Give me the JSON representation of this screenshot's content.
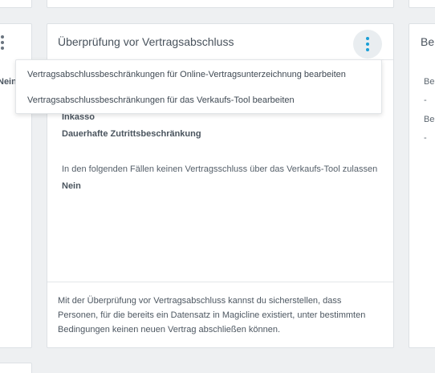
{
  "left_card": {
    "value": "Nein"
  },
  "main_card": {
    "title": "Überprüfung vor Vertragsabschluss",
    "items": [
      {
        "label": "Inkasso"
      },
      {
        "label": "Dauerhafte Zutrittsbeschränkung"
      }
    ],
    "question": "In den folgenden Fällen keinen Vertragsschluss über das Verkaufs-Tool zulassen",
    "answer": "Nein",
    "footer": "Mit der Überprüfung vor Vertragsabschluss kannst du sicherstellen, dass Personen, für die bereits ein Datensatz in Magicline existiert, unter bestimmten Bedingungen keinen neuen Vertrag abschließen können."
  },
  "dropdown_menu": {
    "items": [
      {
        "label": "Vertragsabschlussbeschränkungen für Online-Vertragsunterzeichnung bearbeiten"
      },
      {
        "label": "Vertragsabschlussbeschränkungen für das Verkaufs-Tool bearbeiten"
      }
    ]
  },
  "right_card": {
    "title": "Ber",
    "lines": [
      "Be",
      "-",
      "Be",
      "-"
    ]
  },
  "colors": {
    "accent": "#1a9fd6",
    "background": "#eef0f2",
    "card": "#ffffff"
  }
}
